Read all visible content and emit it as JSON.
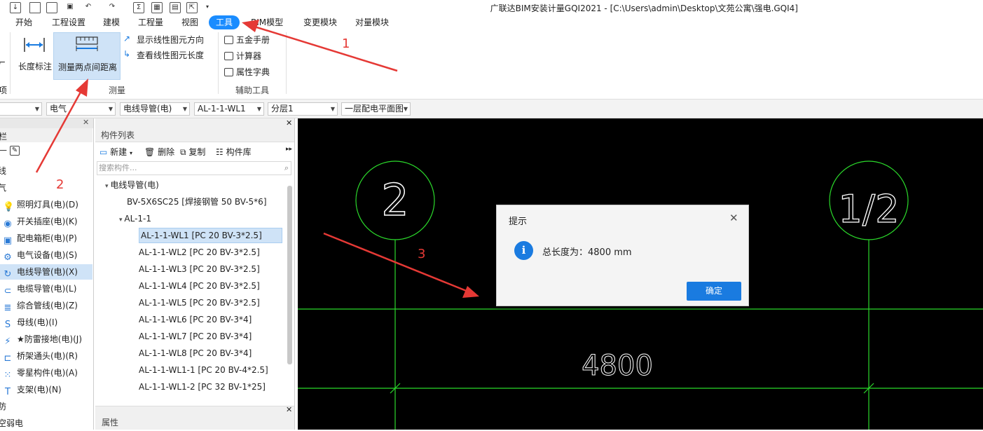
{
  "app": {
    "title": "广联达BIM安装计量GQI2021 - [C:\\Users\\admin\\Desktop\\文苑公寓\\强电.GQI4]"
  },
  "tabs": [
    {
      "label": "开始"
    },
    {
      "label": "工程设置"
    },
    {
      "label": "建模"
    },
    {
      "label": "工程量"
    },
    {
      "label": "视图"
    },
    {
      "label": "工具"
    },
    {
      "label": "BIM模型"
    },
    {
      "label": "变更模块"
    },
    {
      "label": "对量模块"
    }
  ],
  "ribbon": {
    "length_dim": "长度标注",
    "measure_two_points": "测量两点间距离",
    "show_direction": "显示线性图元方向",
    "view_length": "查看线性图元长度",
    "group_measure": "测量",
    "hardware_manual": "五金手册",
    "calculator": "计算器",
    "attr_dict": "属性字典",
    "group_aux": "辅助工具",
    "edge_fragment": "项"
  },
  "combos": [
    "电气",
    "电线导管(电)",
    "AL-1-1-WL1",
    "分层1",
    "一层配电平面图"
  ],
  "left_nav": {
    "header_fragment": "栏",
    "items": [
      {
        "label": "线",
        "icon": "none",
        "indent": false
      },
      {
        "label": "气",
        "icon": "none",
        "indent": false
      },
      {
        "label": "照明灯具(电)(D)",
        "icon": "bulb-icon",
        "indent": true
      },
      {
        "label": "开关插座(电)(K)",
        "icon": "switch-icon",
        "indent": true
      },
      {
        "label": "配电箱柜(电)(P)",
        "icon": "panel-icon",
        "indent": true
      },
      {
        "label": "电气设备(电)(S)",
        "icon": "device-icon",
        "indent": true
      },
      {
        "label": "电线导管(电)(X)",
        "icon": "conduit-icon",
        "indent": true,
        "selected": true
      },
      {
        "label": "电缆导管(电)(L)",
        "icon": "cable-icon",
        "indent": true
      },
      {
        "label": "综合管线(电)(Z)",
        "icon": "pipeline-icon",
        "indent": true
      },
      {
        "label": "母线(电)(I)",
        "icon": "busbar-icon",
        "indent": true
      },
      {
        "label": "★防雷接地(电)(J)",
        "icon": "lightning-icon",
        "indent": true
      },
      {
        "label": "桥架通头(电)(R)",
        "icon": "tray-icon",
        "indent": true
      },
      {
        "label": "零星构件(电)(A)",
        "icon": "grid-icon",
        "indent": true
      },
      {
        "label": "支架(电)(N)",
        "icon": "bracket-icon",
        "indent": true
      },
      {
        "label": "防",
        "icon": "none",
        "indent": false
      },
      {
        "label": "空弱电",
        "icon": "none",
        "indent": false
      }
    ]
  },
  "component_list": {
    "title": "构件列表",
    "new": "新建",
    "delete": "删除",
    "copy": "复制",
    "library": "构件库",
    "search_placeholder": "搜索构件...",
    "props_title": "属性",
    "tree": [
      {
        "label": "电线导管(电)",
        "level": 0,
        "expand": true
      },
      {
        "label": "BV-5X6SC25 [焊接钢管 50 BV-5*6]",
        "level": 1
      },
      {
        "label": "AL-1-1",
        "level": 1,
        "expand": true
      },
      {
        "label": "AL-1-1-WL1 [PC 20 BV-3*2.5]",
        "level": 2,
        "selected": true
      },
      {
        "label": "AL-1-1-WL2 [PC 20 BV-3*2.5]",
        "level": 2
      },
      {
        "label": "AL-1-1-WL3 [PC 20 BV-3*2.5]",
        "level": 2
      },
      {
        "label": "AL-1-1-WL4 [PC 20 BV-3*2.5]",
        "level": 2
      },
      {
        "label": "AL-1-1-WL5 [PC 20 BV-3*2.5]",
        "level": 2
      },
      {
        "label": "AL-1-1-WL6 [PC 20 BV-3*4]",
        "level": 2
      },
      {
        "label": "AL-1-1-WL7 [PC 20 BV-3*4]",
        "level": 2
      },
      {
        "label": "AL-1-1-WL8 [PC 20 BV-3*4]",
        "level": 2
      },
      {
        "label": "AL-1-1-WL1-1 [PC 20 BV-4*2.5]",
        "level": 2
      },
      {
        "label": "AL-1-1-WL1-2 [PC 32 BV-1*25]",
        "level": 2
      }
    ]
  },
  "canvas": {
    "axis_left": "2",
    "axis_right": "1/2",
    "dimension": "4800"
  },
  "dialog": {
    "title": "提示",
    "message": "总长度为：4800 mm",
    "ok": "确定"
  },
  "annotations": [
    "1",
    "2",
    "3"
  ],
  "colors": {
    "accent": "#1a8cff",
    "cad_line": "#2bd92b",
    "arrow": "#e53935"
  }
}
